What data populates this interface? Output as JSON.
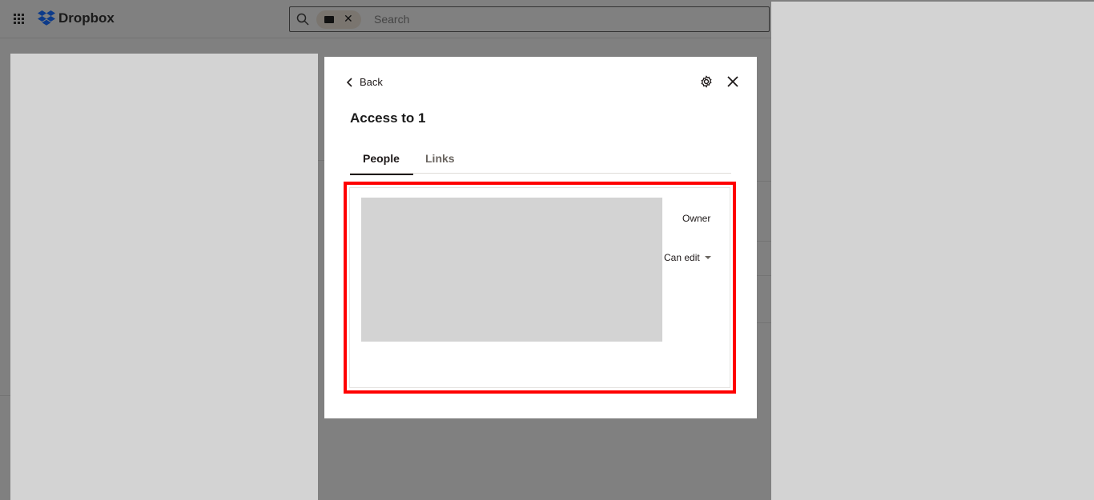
{
  "header": {
    "brand": "Dropbox",
    "search": {
      "placeholder": "Search",
      "chip_icon": "folder-icon"
    }
  },
  "modal": {
    "back_label": "Back",
    "title": "Access to 1",
    "tabs": [
      {
        "label": "People",
        "active": true
      },
      {
        "label": "Links",
        "active": false
      }
    ],
    "members": [
      {
        "role": "Owner"
      },
      {
        "role": "Can edit",
        "dropdown": true
      }
    ]
  },
  "colors": {
    "highlight": "#ff0000",
    "brand": "#0061fe",
    "overlay": "#808080"
  }
}
